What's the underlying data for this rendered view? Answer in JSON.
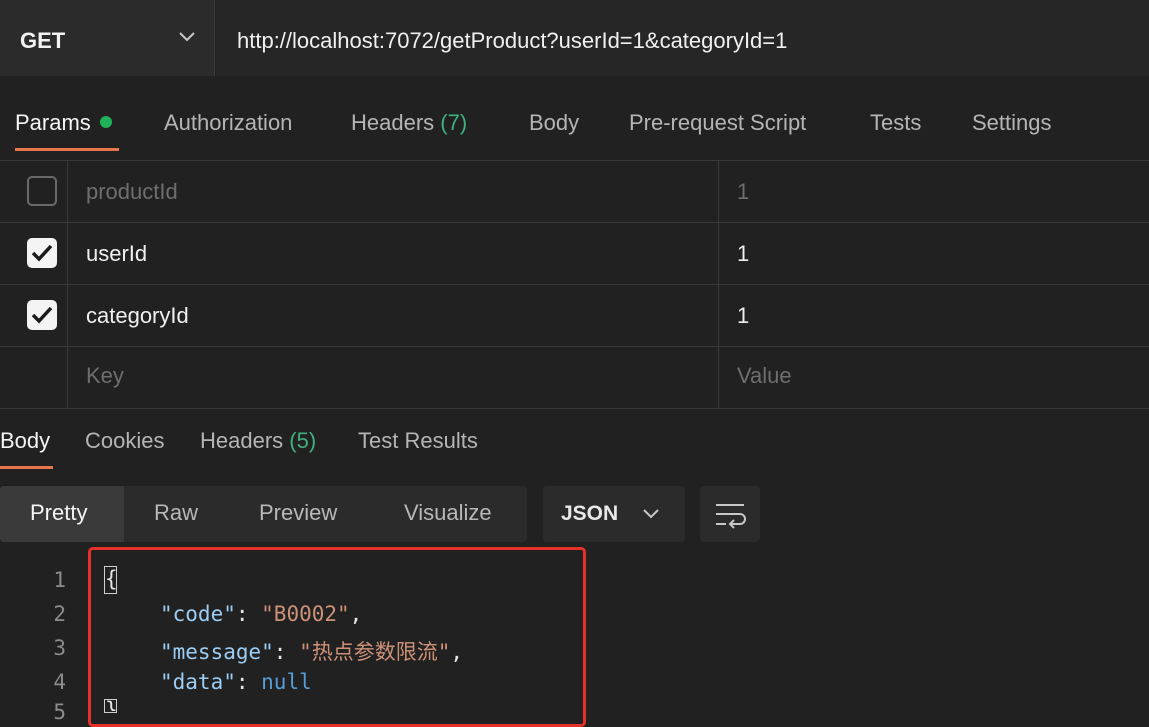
{
  "request": {
    "method": "GET",
    "url": "http://localhost:7072/getProduct?userId=1&categoryId=1"
  },
  "request_tabs": {
    "params": "Params",
    "authorization": "Authorization",
    "headers": "Headers",
    "headers_count": "(7)",
    "body": "Body",
    "prerequest": "Pre-request Script",
    "tests": "Tests",
    "settings": "Settings"
  },
  "params": {
    "rows": [
      {
        "key": "productId",
        "value": "1",
        "checked": false
      },
      {
        "key": "userId",
        "value": "1",
        "checked": true
      },
      {
        "key": "categoryId",
        "value": "1",
        "checked": true
      }
    ],
    "key_placeholder": "Key",
    "value_placeholder": "Value"
  },
  "response_tabs": {
    "body": "Body",
    "cookies": "Cookies",
    "headers": "Headers",
    "headers_count": "(5)",
    "test_results": "Test Results"
  },
  "format": {
    "pretty": "Pretty",
    "raw": "Raw",
    "preview": "Preview",
    "visualize": "Visualize",
    "language": "JSON"
  },
  "response_body": {
    "line_numbers": [
      "1",
      "2",
      "3",
      "4",
      "5"
    ],
    "open_brace": "{",
    "close_brace": "}",
    "code_key": "\"code\"",
    "code_value": "\"B0002\"",
    "message_key": "\"message\"",
    "message_value": "\"热点参数限流\"",
    "data_key": "\"data\"",
    "data_value": "null"
  },
  "colors": {
    "accent": "#e8754c",
    "count_green": "#3fb17d",
    "status_dot": "#1fb25a",
    "highlight_border": "#e5312a"
  }
}
